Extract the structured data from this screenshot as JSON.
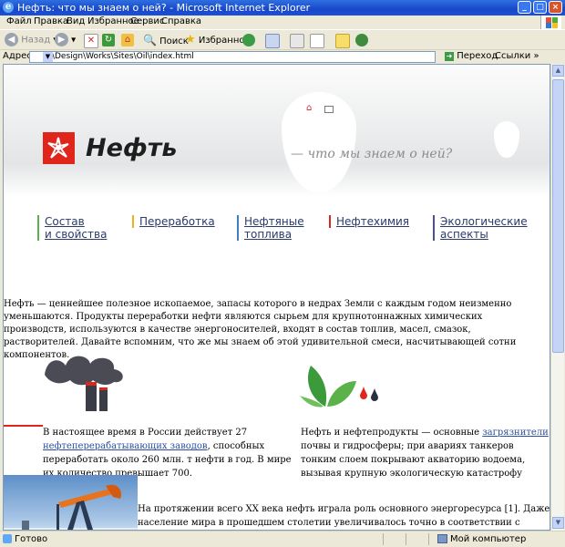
{
  "window": {
    "title": "Нефть: что мы знаем о ней? - Microsoft Internet Explorer"
  },
  "menu": [
    "Файл",
    "Правка",
    "Вид",
    "Избранное",
    "Сервис",
    "Справка"
  ],
  "toolbar": {
    "back": "Назад",
    "search": "Поиск",
    "favorites": "Избранное"
  },
  "address": {
    "label": "Адрес:",
    "url": "D:\\Design\\Works\\Sites\\Oil\\index.html",
    "go": "Переход",
    "links": "Ссылки"
  },
  "page": {
    "logo": "Нефть",
    "tagline": "— что мы знаем о ней?",
    "nav": [
      {
        "line1": "Состав",
        "line2": "и свойства",
        "color": "#5bb24a"
      },
      {
        "line1": "Переработка",
        "line2": "",
        "color": "#f0b21c"
      },
      {
        "line1": "Нефтяные",
        "line2": "топлива",
        "color": "#3e7fc8"
      },
      {
        "line1": "Нефтехимия",
        "line2": "",
        "color": "#d7281f"
      },
      {
        "line1": "Экологические",
        "line2": "аспекты",
        "color": "#4a4f9e"
      }
    ],
    "intro": "Нефть — ценнейшее полезное ископаемое, запасы которого в недрах Земли с каждым годом неизменно уменьшаются. Продукты переработки нефти являются сырьем для крупнотоннажных химических производств, используются в качестве энергоносителей, входят в состав топлив, масел, смазок, растворителей. Давайте вспомним, что же мы знаем об этой удивительной смеси, насчитывающей сотни компонентов.",
    "col1": {
      "before": "В настоящее время в России действует 27 ",
      "link": "нефтеперерабатывающих заводов",
      "after": ", способных переработать около 260 млн. т нефти в год. В мире их количество превышает 700."
    },
    "col2": {
      "before": "Нефть и нефтепродукты — основные ",
      "link": "загрязнители",
      "after": " почвы и гидросферы; при авариях танкеров тонким слоем покрывают акваторию водоема, вызывая крупную экологическую катастрофу"
    },
    "para3": "На протяжении всего XX века нефть играла роль основного энергоресурса [1]. Даже население мира в прошедшем столетии увеличивалось точно в соответствии с ростом добычи нефти —"
  },
  "status": {
    "left": "Готово",
    "right": "Мой компьютер"
  },
  "colors": {
    "brand_red": "#e0251b",
    "titlebar": "#1748c9"
  }
}
